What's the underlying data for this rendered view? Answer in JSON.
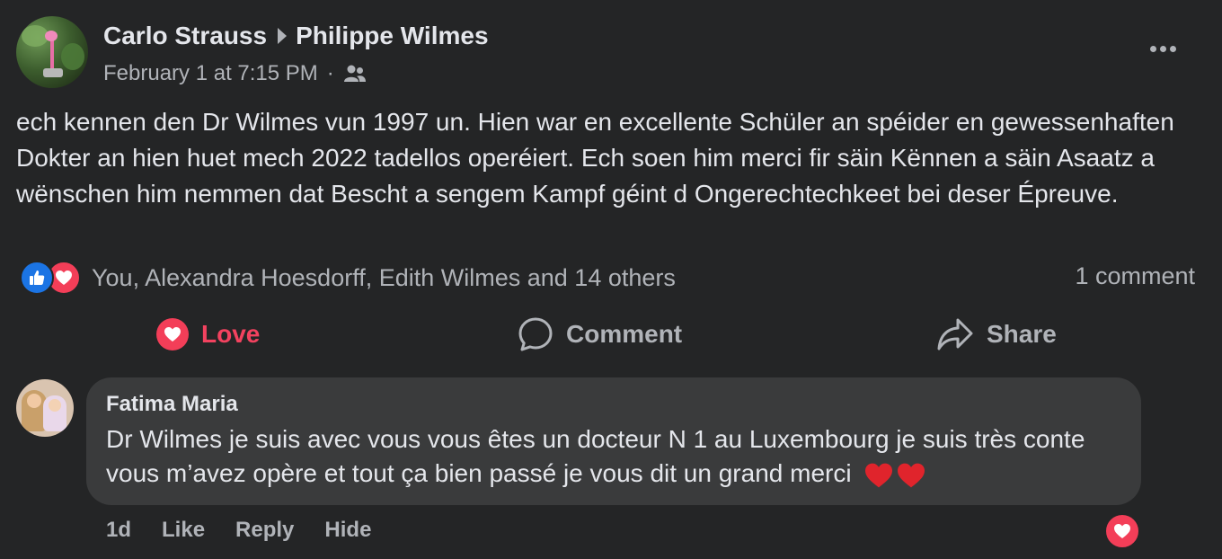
{
  "post": {
    "author": "Carlo Strauss",
    "recipient": "Philippe Wilmes",
    "timestamp": "February 1 at 7:15 PM",
    "separator": "·",
    "audience_icon": "friends-icon",
    "text": "ech kennen den Dr Wilmes vun 1997 un. Hien war en excellente Schüler an spéider en gewessenhaften Dokter an hien huet mech 2022 tadellos operéiert. Ech soen him merci fir säin Kënnen a säin Asaatz a wënschen him nemmen dat Bescht a sengem Kampf géint d Ongerechtechkeet bei deser Épreuve."
  },
  "reactions": {
    "types": [
      "like",
      "love"
    ],
    "summary": "You, Alexandra Hoesdorff, Edith Wilmes and 14 others",
    "comment_count": "1 comment"
  },
  "actions": {
    "love": "Love",
    "comment": "Comment",
    "share": "Share"
  },
  "comment": {
    "author": "Fatima Maria",
    "text": "Dr Wilmes je suis avec vous vous êtes un docteur N 1 au Luxembourg je suis très conte vous m’avez opère et tout ça bien passé je vous dit un grand merci",
    "emoji": "❤️❤️",
    "age": "1d",
    "like": "Like",
    "reply": "Reply",
    "hide": "Hide",
    "reaction": "love"
  },
  "colors": {
    "background": "#242526",
    "bubble": "#3a3b3c",
    "text_primary": "#e4e6eb",
    "text_secondary": "#b0b3b8",
    "like_blue": "#1b74e4",
    "love_red": "#f33e58"
  }
}
